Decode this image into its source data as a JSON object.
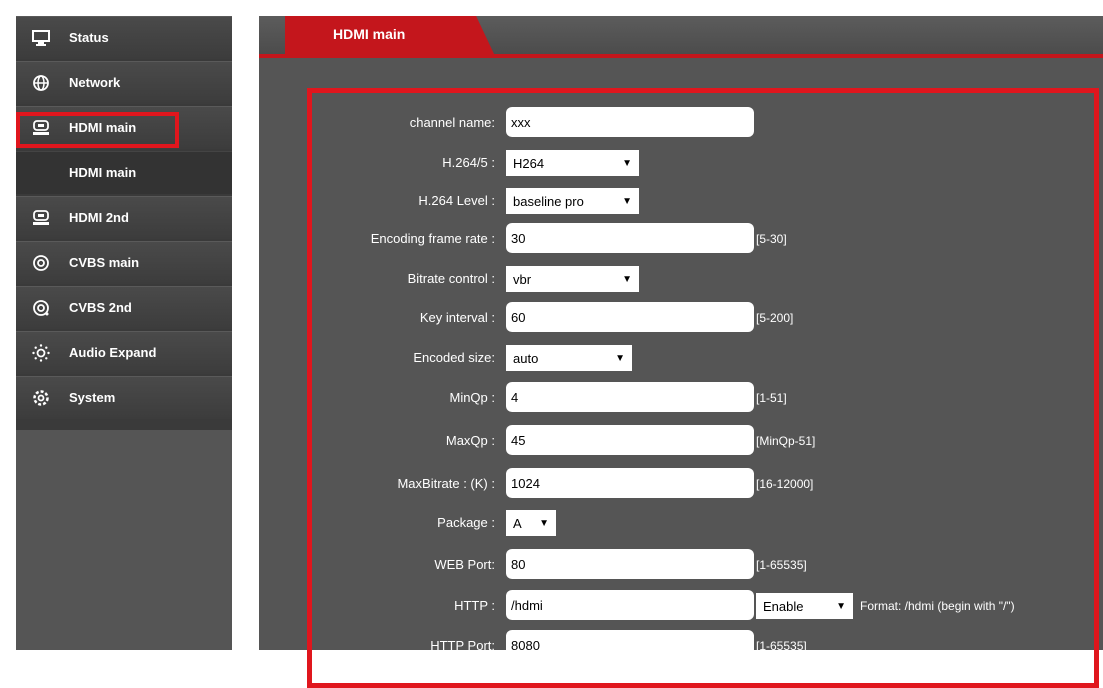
{
  "sidebar": {
    "items": [
      {
        "label": "Status",
        "icon": "monitor-icon"
      },
      {
        "label": "Network",
        "icon": "globe-icon"
      },
      {
        "label": "HDMI main",
        "icon": "hdmi-device-icon"
      },
      {
        "label": "HDMI main"
      },
      {
        "label": "HDMI 2nd",
        "icon": "hdmi-device-icon"
      },
      {
        "label": "CVBS main",
        "icon": "target-icon"
      },
      {
        "label": "CVBS 2nd",
        "icon": "target-icon"
      },
      {
        "label": "Audio Expand",
        "icon": "audio-expand-icon"
      },
      {
        "label": "System",
        "icon": "settings-icon"
      }
    ]
  },
  "tab": {
    "label": "HDMI main"
  },
  "form": {
    "channel_name": {
      "label": "channel name:",
      "value": "xxx"
    },
    "h264_5": {
      "label": "H.264/5 :",
      "value": "H264"
    },
    "h264_level": {
      "label": "H.264 Level :",
      "value": "baseline pro"
    },
    "frame_rate": {
      "label": "Encoding frame rate :",
      "value": "30",
      "hint": "[5-30]"
    },
    "bitrate_control": {
      "label": "Bitrate control :",
      "value": "vbr"
    },
    "key_interval": {
      "label": "Key interval :",
      "value": "60",
      "hint": "[5-200]"
    },
    "encoded_size": {
      "label": "Encoded size:",
      "value": "auto"
    },
    "minqp": {
      "label": "MinQp :",
      "value": "4",
      "hint": "[1-51]"
    },
    "maxqp": {
      "label": "MaxQp :",
      "value": "45",
      "hint": "[MinQp-51]"
    },
    "maxbitrate": {
      "label": "MaxBitrate : (K) :",
      "value": "1024",
      "hint": "[16-12000]"
    },
    "package": {
      "label": "Package :",
      "value": "A"
    },
    "web_port": {
      "label": "WEB Port:",
      "value": "80",
      "hint": "[1-65535]"
    },
    "http": {
      "label": "HTTP :",
      "value": "/hdmi",
      "toggle": "Enable",
      "format": "Format: /hdmi (begin with \"/\")"
    },
    "http_port": {
      "label": "HTTP Port:",
      "value": "8080",
      "hint": "[1-65535]"
    }
  },
  "colors": {
    "accent": "#c4161c",
    "highlight": "#e0161d",
    "panel": "#555555",
    "sidebar": "#3a3a3a"
  }
}
